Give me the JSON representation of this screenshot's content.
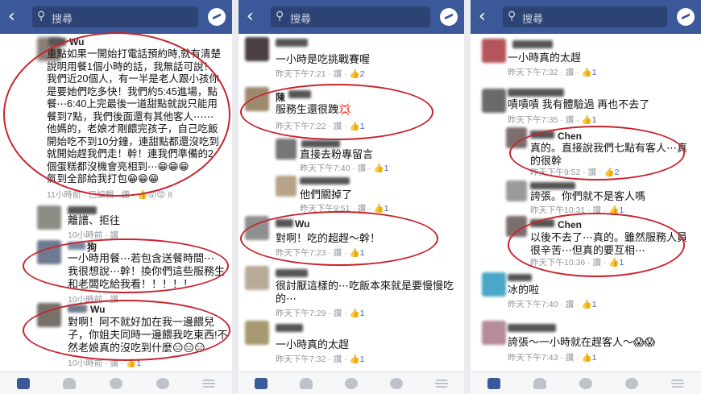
{
  "search": {
    "placeholder": "搜尋"
  },
  "panel1": {
    "c1": {
      "name": "Wu",
      "lines": [
        "重點如果一開始打電話預約時,就有清楚",
        "說明用餐1個小時的話，我無話可說！",
        "我們近20個人，有一半是老人跟小孩你",
        "是要她們吃多快！我們約5:45進場，點",
        "餐⋯6:40上完最後一道甜點就說只能用",
        "餐到7點，我們後面還有其他客人⋯⋯",
        "他媽的，老娘才剛餵完孩子，自己吃飯",
        "開始吃不到10分鐘，連甜點都還沒吃到",
        "就開始趕我們走！幹！連我們準備的2",
        "個蛋糕都沒機會亮相到⋯😁😁😁",
        "氣到全部給我打包😁😁😁"
      ],
      "meta": "11小時前 · 已編輯 · 讚 · 👍😮😡 8"
    },
    "c2": {
      "text": "離譜、拒往",
      "meta": "10小時前 · 讚"
    },
    "c3": {
      "name": "狗",
      "lines": [
        "一小時用餐⋯若包含送餐時間⋯",
        "我很想說⋯幹！換你們這些服務生",
        "和老闆吃給我看！！！！！"
      ],
      "meta": "10小時前 · 讚"
    },
    "c4": {
      "name": "Wu",
      "lines": [
        "對啊！阿不就好加在我一邊餵兒",
        "子，你姐夫同時一邊餵我吃東西!不",
        "然老娘真的沒吃到什麼😑😑😑"
      ],
      "meta": "10小時前 · 讚 · ",
      "likes": "👍1"
    }
  },
  "panel2": {
    "c1": {
      "text": "一小時是吃挑戰賽喔",
      "meta": "昨天下午7:21 · 讚 · ",
      "likes": "👍2"
    },
    "c2": {
      "name": "陳",
      "text": "服務生還很跩💢",
      "meta": "昨天下午7:22 · 讚 · ",
      "likes": "👍1"
    },
    "c3": {
      "text": "直接去粉專留言",
      "meta": "昨天下午7:40 · 讚 · ",
      "likes": "👍1"
    },
    "c4": {
      "text": "他們關掉了",
      "meta": "昨天下午9:51 · 讚 · ",
      "likes": "👍1"
    },
    "c5": {
      "name": "Wu",
      "text": "對啊！吃的超趕～幹！",
      "meta": "昨天下午7:23 · 讚 · ",
      "likes": "👍1"
    },
    "c6": {
      "lines": [
        "很討厭這樣的⋯吃飯本來就是要慢慢吃",
        "的⋯"
      ],
      "meta": "昨天下午7:29 · 讚 · ",
      "likes": "👍1"
    },
    "c7": {
      "text": "一小時真的太趕",
      "meta": "昨天下午7:32 · 讚 · ",
      "likes": "👍1"
    }
  },
  "panel3": {
    "c1": {
      "text": "一小時真的太趕",
      "meta": "昨天下午7:32 · 讚 · ",
      "likes": "👍1"
    },
    "c2": {
      "text": "嘖嘖嘖 我有體驗過 再也不去了",
      "meta": "昨天下午7:35 · 讚 · ",
      "likes": "👍1"
    },
    "c3": {
      "name": "Chen",
      "lines": [
        "真的。直接說我們七點有客人⋯真",
        "的很幹"
      ],
      "meta": "昨天下午9:52 · 讚 · ",
      "likes": "👍2"
    },
    "c4": {
      "text": "誇張。你們就不是客人嗎",
      "meta": "昨天下午10:31 · 讚 · ",
      "likes": "👍1"
    },
    "c5": {
      "name": "Chen",
      "lines": [
        "以後不去了⋯真的。雖然服務人員",
        "很辛苦⋯但真的要互相⋯"
      ],
      "meta": "昨天下午10:36 · 讚 · ",
      "likes": "👍1"
    },
    "c6": {
      "text": "冰的啦",
      "meta": "昨天下午7:40 · 讚 · ",
      "likes": "👍1"
    },
    "c7": {
      "text": "誇張～一小時就在趕客人～😱😱",
      "meta": "昨天下午7:43 · 讚 · ",
      "likes": "👍1"
    }
  }
}
